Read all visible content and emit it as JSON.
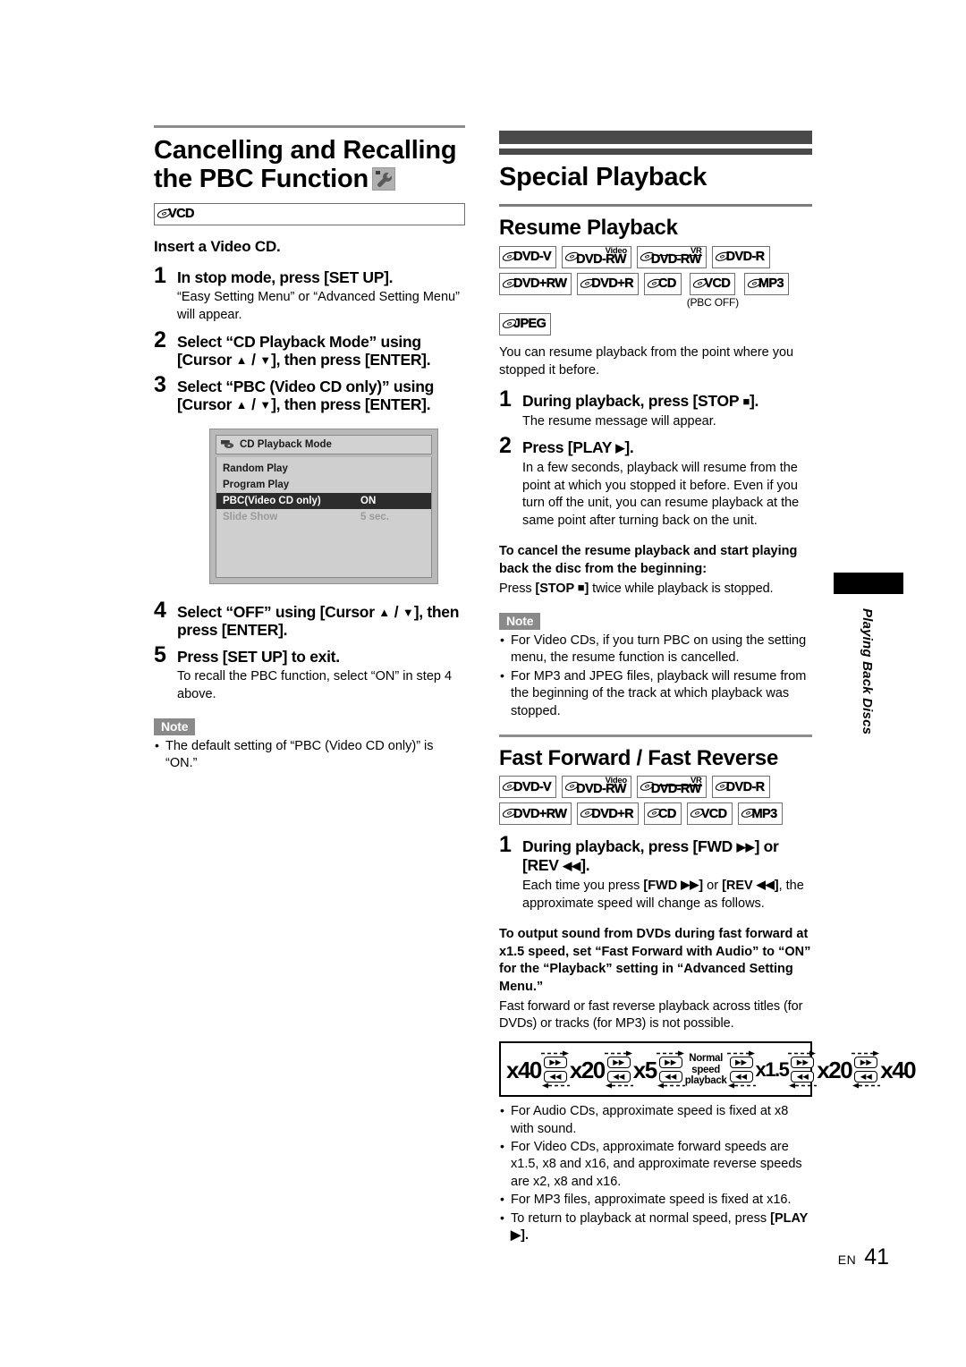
{
  "left_column": {
    "heading": "Cancelling and Recalling the PBC Function",
    "heading_icon": "wrench-icon",
    "badge": {
      "label": "VCD"
    },
    "lead": "Insert a Video CD.",
    "steps": [
      {
        "num": "1",
        "title": "In stop mode, press [SET UP].",
        "desc": "“Easy Setting Menu” or “Advanced Setting Menu” will appear."
      },
      {
        "num": "2",
        "title_a": "Select “CD Playback Mode” using [Cursor ",
        "title_b": " / ",
        "title_c": "], then press [ENTER]."
      },
      {
        "num": "3",
        "title_a": "Select “PBC (Video CD only)” using [Cursor ",
        "title_b": " / ",
        "title_c": "], then press [ENTER]."
      },
      {
        "num": "4",
        "title_a": "Select “OFF” using [Cursor ",
        "title_b": " / ",
        "title_c": "], then press [ENTER]."
      },
      {
        "num": "5",
        "title": "Press [SET UP] to exit.",
        "desc": "To recall the PBC function, select “ON” in step 4 above."
      }
    ],
    "osd": {
      "title": "CD Playback Mode",
      "rows": [
        {
          "key": "Random Play",
          "value": "",
          "state": "normal"
        },
        {
          "key": "Program Play",
          "value": "",
          "state": "normal"
        },
        {
          "key": "PBC(Video CD only)",
          "value": "ON",
          "state": "selected"
        },
        {
          "key": "Slide Show",
          "value": "5 sec.",
          "state": "dimmed"
        }
      ]
    },
    "note": {
      "tag": "Note",
      "items": [
        "The default setting of “PBC (Video CD only)” is “ON.”"
      ]
    }
  },
  "right_column": {
    "chapter_title": "Special Playback",
    "resume": {
      "heading": "Resume Playback",
      "badges_row1": [
        {
          "label": "DVD-V",
          "sup": ""
        },
        {
          "label": "DVD-RW",
          "sup": "Video"
        },
        {
          "label": "DVD-RW",
          "sup": "VR"
        },
        {
          "label": "DVD-R",
          "sup": ""
        }
      ],
      "badges_row2": [
        {
          "label": "DVD+RW",
          "sup": "",
          "note": ""
        },
        {
          "label": "DVD+R",
          "sup": "",
          "note": ""
        },
        {
          "label": "CD",
          "sup": "",
          "note": ""
        },
        {
          "label": "VCD",
          "sup": "",
          "note": "(PBC OFF)"
        },
        {
          "label": "MP3",
          "sup": "",
          "note": ""
        }
      ],
      "badges_row3": [
        {
          "label": "JPEG",
          "sup": "",
          "note": ""
        }
      ],
      "intro": "You can resume playback from the point where you stopped it before.",
      "steps": [
        {
          "num": "1",
          "title_a": "During playback, press [STOP ",
          "title_c": "].",
          "desc": "The resume message will appear."
        },
        {
          "num": "2",
          "title_a": "Press [PLAY ",
          "title_c": "].",
          "desc": "In a few seconds, playback will resume from the point at which you stopped it before. Even if you turn off the unit, you can resume playback at the same point after turning back on the unit."
        }
      ],
      "cancel_bold": "To cancel the resume playback and start playing back the disc from the beginning:",
      "cancel_a": "Press ",
      "cancel_b": "[STOP ",
      "cancel_c": "]",
      "cancel_d": " twice while playback is stopped.",
      "note": {
        "tag": "Note",
        "items": [
          "For Video CDs, if you turn PBC on using the setting menu, the resume function is cancelled.",
          "For MP3 and JPEG files, playback will resume from the beginning of the track at which playback was stopped."
        ]
      }
    },
    "fast": {
      "heading": "Fast Forward / Fast Reverse",
      "badges_row1": [
        {
          "label": "DVD-V",
          "sup": ""
        },
        {
          "label": "DVD-RW",
          "sup": "Video"
        },
        {
          "label": "DVD-RW",
          "sup": "VR"
        },
        {
          "label": "DVD-R",
          "sup": ""
        }
      ],
      "badges_row2": [
        {
          "label": "DVD+RW",
          "sup": ""
        },
        {
          "label": "DVD+R",
          "sup": ""
        },
        {
          "label": "CD",
          "sup": ""
        },
        {
          "label": "VCD",
          "sup": ""
        },
        {
          "label": "MP3",
          "sup": ""
        }
      ],
      "step": {
        "num": "1",
        "title_a": "During playback, press [FWD ",
        "title_b": "] or [REV ",
        "title_c": "].",
        "desc_a": "Each time you press ",
        "desc_b": "[FWD ",
        "desc_c": "]",
        "desc_d": " or ",
        "desc_e": "[REV ",
        "desc_f": "]",
        "desc_g": ", the approximate speed will change as follows."
      },
      "audio_bold": "To output sound from DVDs during fast forward at x1.5 speed, set “Fast Forward with Audio” to “ON” for the “Playback” setting in “Advanced Setting Menu.”",
      "audio_plain": "Fast forward or fast reverse playback across titles (for DVDs) or tracks (for MP3) is not possible.",
      "speed_diagram": {
        "left_speeds": [
          "x40",
          "x20",
          "x5"
        ],
        "center_label": "Normal speed playback",
        "right_speeds": [
          "x1.5",
          "x20",
          "x40"
        ],
        "fwd_glyph": "▶▶",
        "rev_glyph": "◀◀"
      },
      "notes": [
        "For Audio CDs, approximate speed is fixed at x8 with sound.",
        "For Video CDs, approximate forward speeds are x1.5, x8 and x16, and approximate reverse speeds are x2, x8 and x16.",
        "For MP3 files, approximate speed is fixed at x16.",
        "To return to playback at normal speed, press [PLAY ▶]."
      ],
      "note_last_a": "To return to playback at normal speed, press ",
      "note_last_bold": "[PLAY ▶]."
    }
  },
  "side_tab": {
    "text": "Playing Back Discs"
  },
  "footer": {
    "lang": "EN",
    "page": "41"
  }
}
